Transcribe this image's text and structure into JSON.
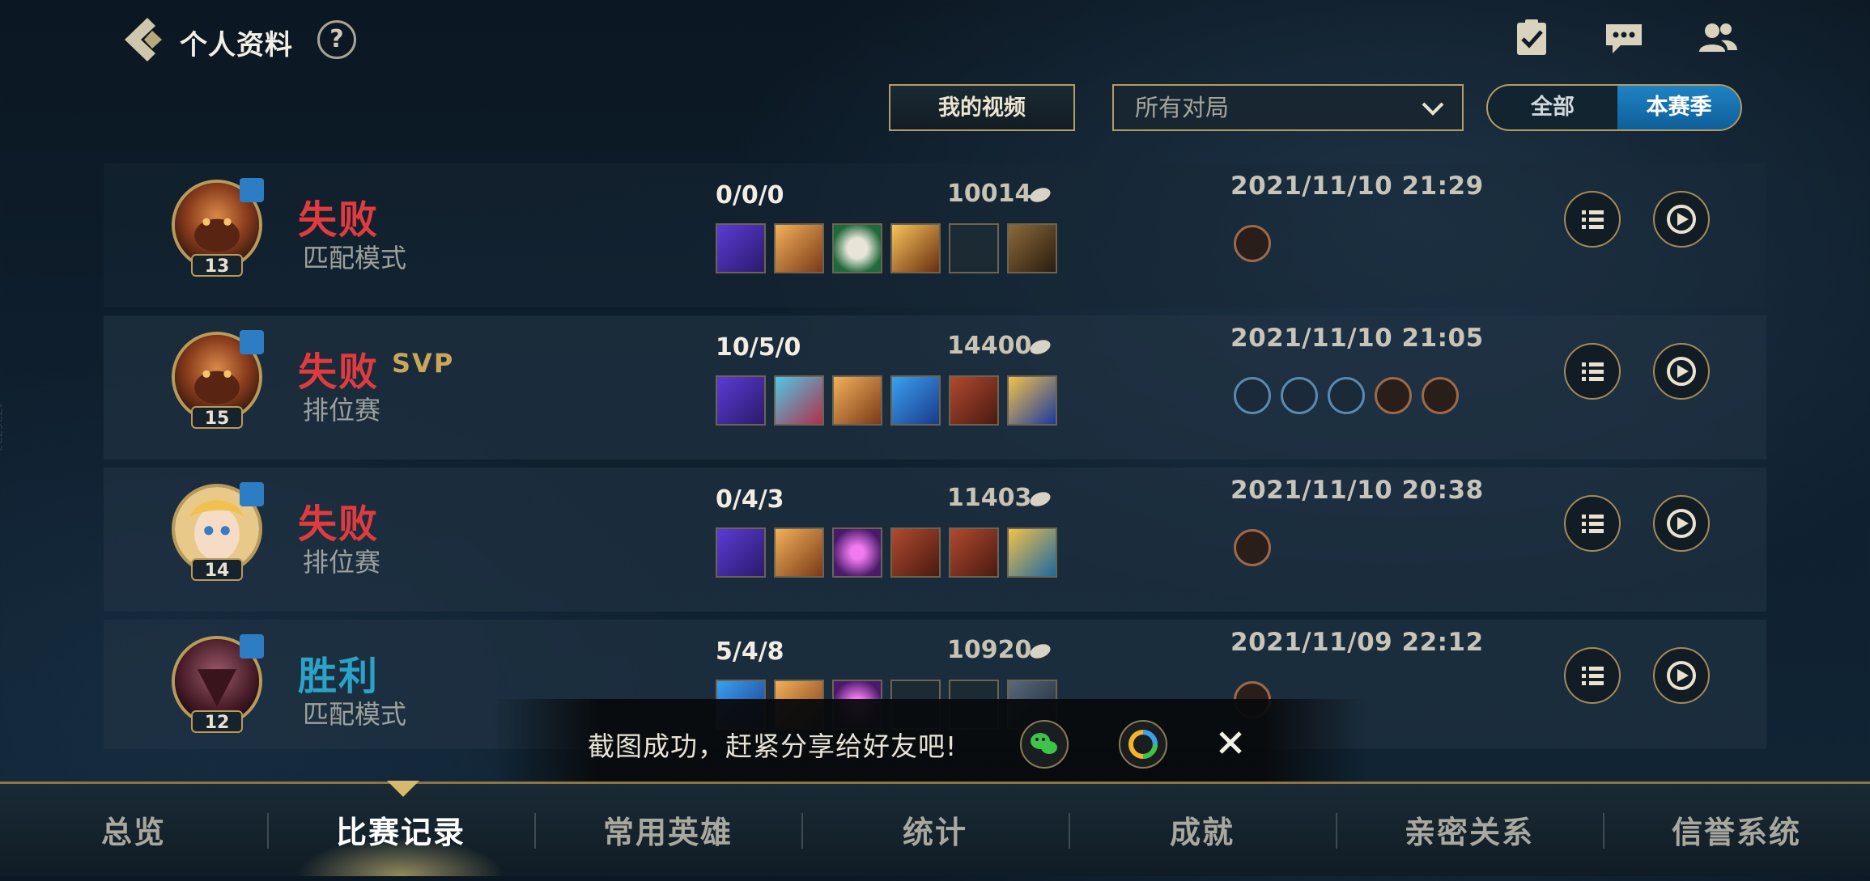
{
  "header": {
    "title": "个人资料",
    "help": "?",
    "icons": [
      "task-icon",
      "chat-icon",
      "friends-icon"
    ]
  },
  "filters": {
    "video_button": "我的视频",
    "match_select": "所有对局",
    "segment": {
      "all": "全部",
      "season": "本赛季",
      "selected": "本赛季"
    }
  },
  "matches": [
    {
      "result": "失败",
      "result_type": "lose",
      "svp": "",
      "mode": "匹配模式",
      "level": "13",
      "kda": "0/0/0",
      "gold": "10014",
      "date": "2021/11/10 21:29",
      "badge_count": 1
    },
    {
      "result": "失败",
      "result_type": "lose",
      "svp": "SVP",
      "mode": "排位赛",
      "level": "15",
      "kda": "10/5/0",
      "gold": "14400",
      "date": "2021/11/10 21:05",
      "badge_count": 5
    },
    {
      "result": "失败",
      "result_type": "lose",
      "svp": "",
      "mode": "排位赛",
      "level": "14",
      "kda": "0/4/3",
      "gold": "11403",
      "date": "2021/11/10 20:38",
      "badge_count": 1
    },
    {
      "result": "胜利",
      "result_type": "win",
      "svp": "",
      "mode": "匹配模式",
      "level": "12",
      "kda": "5/4/8",
      "gold": "10920",
      "date": "2021/11/09 22:12",
      "badge_count": 1
    }
  ],
  "toast": {
    "message": "截图成功，赶紧分享给好友吧!",
    "share_targets": [
      "wechat-icon",
      "moments-icon"
    ]
  },
  "nav": {
    "tabs": [
      "总览",
      "比赛记录",
      "常用英雄",
      "统计",
      "成就",
      "亲密关系",
      "信誉系统"
    ],
    "active": "比赛记录"
  },
  "side_id": "4726723",
  "colors": {
    "lose": "#e23b3f",
    "win": "#2ba3c8",
    "gold_border": "#b39d63",
    "active_blue": "#1f83c3"
  }
}
